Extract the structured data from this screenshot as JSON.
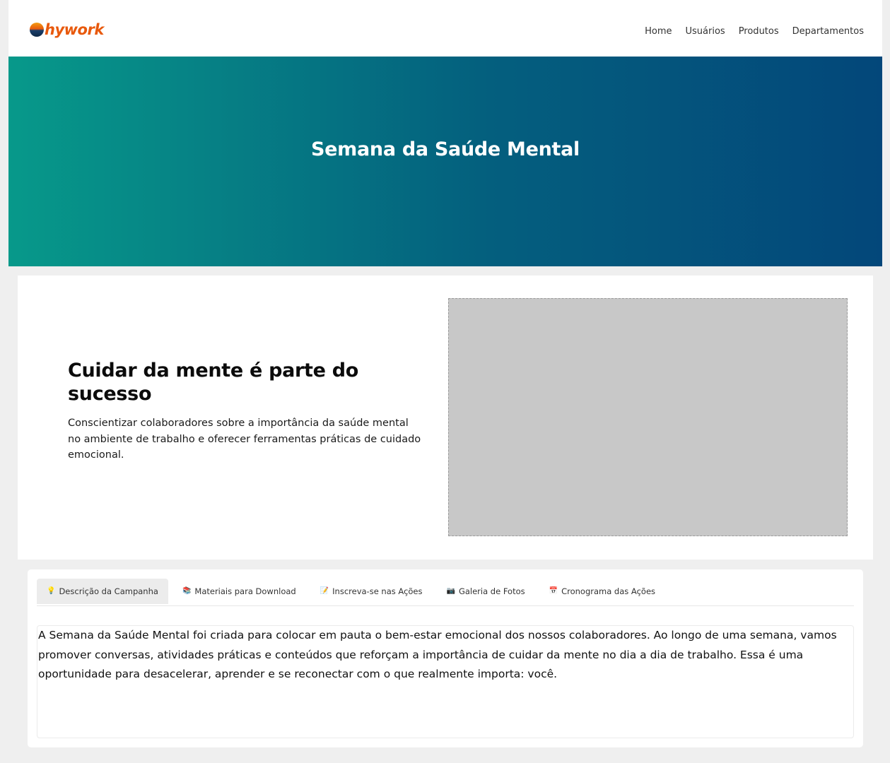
{
  "header": {
    "logo_text": "hywork",
    "nav": [
      {
        "label": "Home"
      },
      {
        "label": "Usuários"
      },
      {
        "label": "Produtos"
      },
      {
        "label": "Departamentos"
      }
    ]
  },
  "hero": {
    "title": "Semana da Saúde Mental"
  },
  "intro": {
    "heading": "Cuidar da mente é parte do sucesso",
    "text": "Conscientizar colaboradores sobre a importância da saúde mental no ambiente de trabalho e oferecer ferramentas práticas de cuidado emocional.",
    "image_alt": "Campaign photo"
  },
  "tabs": [
    {
      "label": "Descrição da Campanha",
      "icon": "lightbulb-icon",
      "glyph": "💡",
      "active": true
    },
    {
      "label": "Materiais para Download",
      "icon": "books-icon",
      "glyph": "📚",
      "active": false
    },
    {
      "label": "Inscreva-se nas Ações",
      "icon": "memo-icon",
      "glyph": "📝",
      "active": false
    },
    {
      "label": "Galeria de Fotos",
      "icon": "camera-icon",
      "glyph": "📷",
      "active": false
    },
    {
      "label": "Cronograma das Ações",
      "icon": "calendar-icon",
      "glyph": "📅",
      "active": false
    }
  ],
  "description": "A Semana da Saúde Mental foi criada para colocar em pauta o bem-estar emocional dos nossos colaboradores. Ao longo de uma semana, vamos promover conversas, atividades práticas e conteúdos que reforçam a importância de cuidar da mente no dia a dia de trabalho. Essa é uma oportunidade para desacelerar, aprender e se reconectar com o que realmente importa: você.",
  "colors": {
    "brand": "#e8590c",
    "hero_start": "#07998a",
    "hero_end": "#03477a"
  }
}
